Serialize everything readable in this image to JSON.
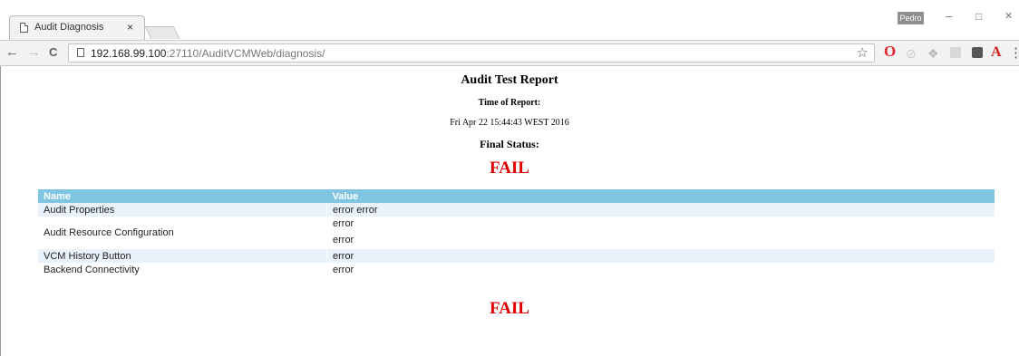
{
  "browser": {
    "tab_title": "Audit Diagnosis",
    "tab_close": "×",
    "profile_label": "Pedro",
    "url_host": "192.168.99.100",
    "url_rest": ":27110/AuditVCMWeb/diagnosis/",
    "win_min": "–",
    "win_max": "□",
    "win_close": "✕",
    "nav_back": "←",
    "nav_forward": "→",
    "nav_reload": "C",
    "star": "☆",
    "extensions": {
      "opera": "O",
      "dropbox": "❖",
      "acrobat": "A",
      "menu": "⋮"
    }
  },
  "report": {
    "title": "Audit Test Report",
    "time_label": "Time of Report:",
    "time_value": "Fri Apr 22 15:44:43 WEST 2016",
    "status_label": "Final Status:",
    "status_top": "FAIL",
    "status_bottom": "FAIL",
    "status_color": "#e00000",
    "header_color": "#7fc4e0"
  },
  "table": {
    "headers": [
      "Name",
      "Value"
    ],
    "rows": [
      {
        "name": "Audit Properties",
        "values": [
          "error error"
        ]
      },
      {
        "name": "Audit Resource Configuration",
        "values": [
          "error",
          "error"
        ]
      },
      {
        "name": "VCM History Button",
        "values": [
          "error"
        ]
      },
      {
        "name": "Backend Connectivity",
        "values": [
          "error"
        ]
      }
    ]
  }
}
